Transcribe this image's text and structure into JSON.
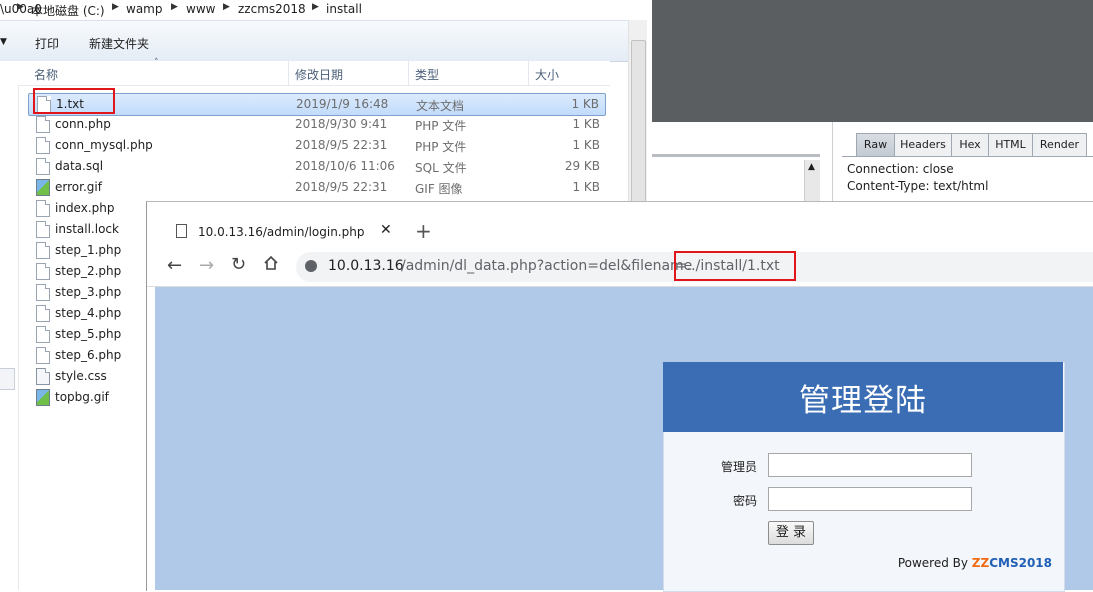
{
  "explorer": {
    "breadcrumb": [
      "本地磁盘 (C:)",
      "wamp",
      "www",
      "zzcms2018",
      "install"
    ],
    "commands": {
      "print": "打印",
      "new_folder": "新建文件夹"
    },
    "columns": {
      "name": "名称",
      "date": "修改日期",
      "type": "类型",
      "size": "大小"
    },
    "files": [
      {
        "name": "1.txt",
        "date": "2019/1/9 16:48",
        "type": "文本文档",
        "size": "1 KB"
      },
      {
        "name": "conn.php",
        "date": "2018/9/30 9:41",
        "type": "PHP 文件",
        "size": "1 KB"
      },
      {
        "name": "conn_mysql.php",
        "date": "2018/9/5 22:31",
        "type": "PHP 文件",
        "size": "1 KB"
      },
      {
        "name": "data.sql",
        "date": "2018/10/6 11:06",
        "type": "SQL 文件",
        "size": "29 KB"
      },
      {
        "name": "error.gif",
        "date": "2018/9/5 22:31",
        "type": "GIF 图像",
        "size": "1 KB"
      },
      {
        "name": "index.php"
      },
      {
        "name": "install.lock"
      },
      {
        "name": "step_1.php"
      },
      {
        "name": "step_2.php"
      },
      {
        "name": "step_3.php"
      },
      {
        "name": "step_4.php"
      },
      {
        "name": "step_5.php"
      },
      {
        "name": "step_6.php"
      },
      {
        "name": "style.css"
      },
      {
        "name": "topbg.gif"
      }
    ]
  },
  "burp": {
    "tabs": [
      "Raw",
      "Headers",
      "Hex",
      "HTML",
      "Render"
    ],
    "response_lines": [
      "Connection: close",
      "Content-Type: text/html"
    ]
  },
  "browser": {
    "tab_title": "10.0.13.16/admin/login.php",
    "url_host": "10.0.13.16",
    "url_path": "/admin/dl_data.php?action=del&filename",
    "url_highlight": "=../install/1.txt"
  },
  "login": {
    "title": "管理登陆",
    "username_label": "管理员",
    "password_label": "密码",
    "submit": "登 录",
    "powered_prefix": "Powered By ",
    "brand_zz": "ZZ",
    "brand_rest": "CMS2018",
    "brand_zz_color": "#f06a13",
    "brand_rest_color": "#1f5fb6"
  }
}
